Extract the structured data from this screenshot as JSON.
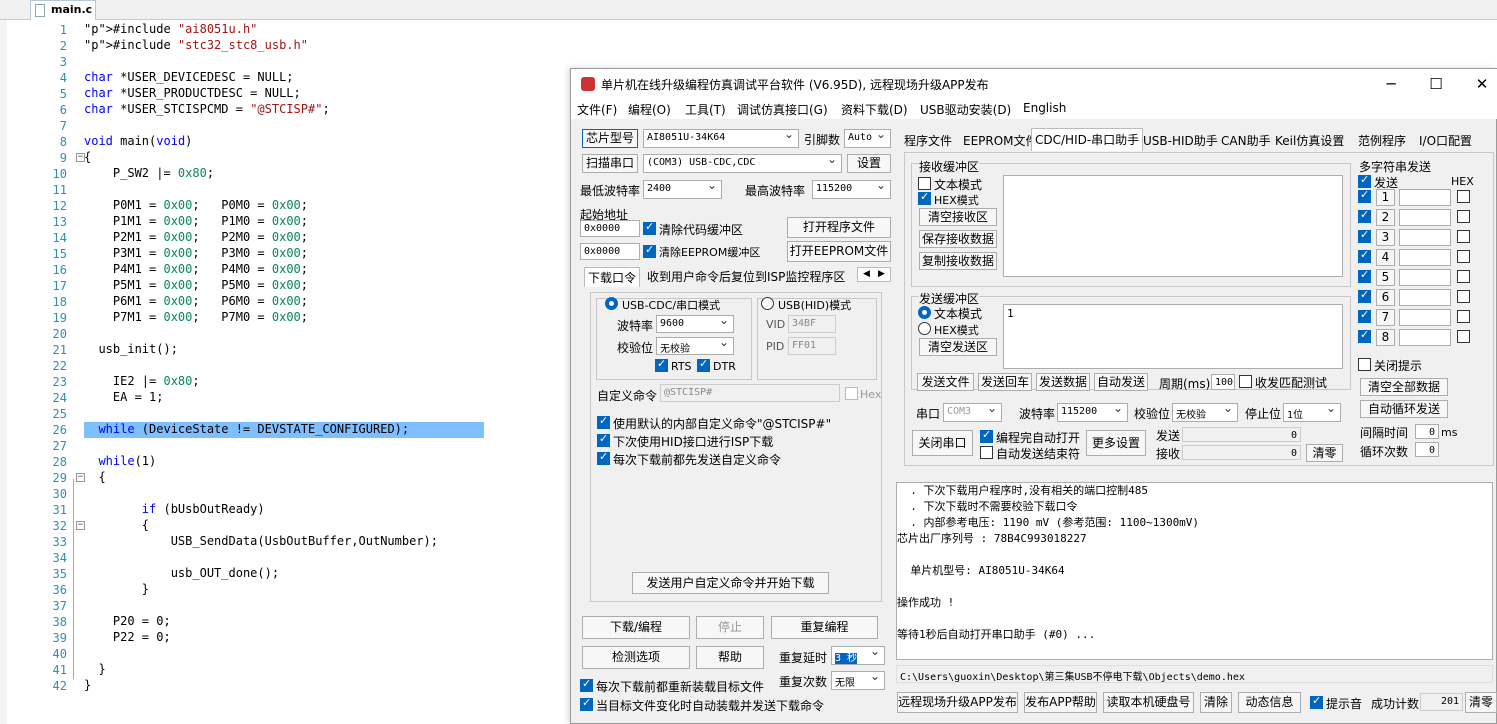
{
  "editor": {
    "tab_label": "main.c",
    "line_numbers": [
      "1",
      "2",
      "3",
      "4",
      "5",
      "6",
      "7",
      "8",
      "9",
      "10",
      "11",
      "12",
      "13",
      "14",
      "15",
      "16",
      "17",
      "18",
      "19",
      "20",
      "21",
      "22",
      "23",
      "24",
      "25",
      "26",
      "27",
      "28",
      "29",
      "30",
      "31",
      "32",
      "33",
      "34",
      "35",
      "36",
      "37",
      "38",
      "39",
      "40",
      "41",
      "42"
    ],
    "lines": {
      "l1": "#include \"ai8051u.h\"",
      "l2": "#include \"stc32_stc8_usb.h\"",
      "l4": "char *USER_DEVICEDESC = NULL;",
      "l5": "char *USER_PRODUCTDESC = NULL;",
      "l6": "char *USER_STCISPCMD = \"@STCISP#\";",
      "l8": "void main(void)",
      "l9": "{",
      "l10": "    P_SW2 |= 0x80;",
      "l12": "    P0M1 = 0x00;   P0M0 = 0x00;",
      "l13": "    P1M1 = 0x00;   P1M0 = 0x00;",
      "l14": "    P2M1 = 0x00;   P2M0 = 0x00;",
      "l15": "    P3M1 = 0x00;   P3M0 = 0x00;",
      "l16": "    P4M1 = 0x00;   P4M0 = 0x00;",
      "l17": "    P5M1 = 0x00;   P5M0 = 0x00;",
      "l18": "    P6M1 = 0x00;   P6M0 = 0x00;",
      "l19": "    P7M1 = 0x00;   P7M0 = 0x00;",
      "l21": "  usb_init();",
      "l23": "    IE2 |= 0x80;",
      "l24": "    EA = 1;",
      "l26": "  while (DeviceState != DEVSTATE_CONFIGURED);",
      "l28": "  while(1)",
      "l29": "  {",
      "l31": "        if (bUsbOutReady)",
      "l32": "        {",
      "l33": "            USB_SendData(UsbOutBuffer,OutNumber);",
      "l35": "            usb_OUT_done();",
      "l36": "        }",
      "l38": "    P20 = 0;",
      "l39": "    P22 = 0;",
      "l41": "  }",
      "l42": "}"
    }
  },
  "window": {
    "title": "单片机在线升级编程仿真调试平台软件 (V6.95D), 远程现场升级APP发布",
    "controls": {
      "minimize": "─",
      "maximize": "☐",
      "close": "✕"
    },
    "menu": [
      "文件(F)",
      "编程(O)",
      "工具(T)",
      "调试仿真接口(G)",
      "资料下载(D)",
      "USB驱动安装(D)",
      "English"
    ]
  },
  "left": {
    "chip_btn": "芯片型号",
    "chip_value": "AI8051U-34K64",
    "pins_label": "引脚数",
    "pins_value": "Auto",
    "scan_btn": "扫描串口",
    "port_value": "(COM3) USB-CDC,CDC",
    "settings_btn": "设置",
    "min_baud_label": "最低波特率",
    "min_baud_value": "2400",
    "max_baud_label": "最高波特率",
    "max_baud_value": "115200",
    "start_addr_label": "起始地址",
    "addr1": "0x0000",
    "clear_code": "清除代码缓冲区",
    "open_prog": "打开程序文件",
    "addr2": "0x0000",
    "clear_eeprom": "清除EEPROM缓冲区",
    "open_eeprom": "打开EEPROM文件",
    "tab1": "下载口令",
    "tab2": "收到用户命令后复位到ISP监控程序区",
    "mode_cdc": "USB-CDC/串口模式",
    "mode_hid": "USB(HID)模式",
    "baud_label": "波特率",
    "baud_value": "9600",
    "parity_label": "校验位",
    "parity_value": "无校验",
    "rts": "RTS",
    "dtr": "DTR",
    "vid_label": "VID",
    "vid_value": "34BF",
    "pid_label": "PID",
    "pid_value": "FF01",
    "custom_cmd_label": "自定义命令",
    "custom_cmd_value": "@STCISP#",
    "hex_label": "Hex",
    "opt1": "使用默认的内部自定义命令\"@STCISP#\"",
    "opt2": "下次使用HID接口进行ISP下载",
    "opt3": "每次下载前都先发送自定义命令",
    "send_cmd_btn": "发送用户自定义命令并开始下载",
    "download_btn": "下载/编程",
    "stop_btn": "停止",
    "reprog_btn": "重复编程",
    "check_btn": "检测选项",
    "help_btn": "帮助",
    "repeat_delay_label": "重复延时",
    "repeat_delay_value": "3 秒",
    "repeat_count_label": "重复次数",
    "repeat_count_value": "无限",
    "reload_each": "每次下载前都重新装载目标文件",
    "auto_reload": "当目标文件变化时自动装载并发送下载命令"
  },
  "right": {
    "tabs": [
      "程序文件",
      "EEPROM文件",
      "CDC/HID-串口助手",
      "USB-HID助手",
      "CAN助手",
      "Keil仿真设置",
      "范例程序",
      "I/O口配置"
    ],
    "recv_group": "接收缓冲区",
    "recv_text_mode": "文本模式",
    "recv_hex_mode": "HEX模式",
    "clear_recv": "清空接收区",
    "save_recv": "保存接收数据",
    "copy_recv": "复制接收数据",
    "send_group": "发送缓冲区",
    "send_text_mode": "文本模式",
    "send_hex_mode": "HEX模式",
    "clear_send": "清空发送区",
    "send_content": "1",
    "send_file": "发送文件",
    "send_enter": "发送回车",
    "send_data": "发送数据",
    "auto_send": "自动发送",
    "period_label": "周期(ms)",
    "period_value": "100",
    "recv_match": "收发匹配测试",
    "multi_title": "多字符串发送",
    "multi_send": "发送",
    "multi_hex": "HEX",
    "multi_rows": [
      "1",
      "2",
      "3",
      "4",
      "5",
      "6",
      "7",
      "8"
    ],
    "close_tip": "关闭提示",
    "clear_all": "清空全部数据",
    "auto_loop": "自动循环发送",
    "interval_label": "间隔时间",
    "interval_value": "0",
    "interval_unit": "ms",
    "loop_label": "循环次数",
    "loop_value": "0",
    "port_label": "串口",
    "port_value": "COM3",
    "baud_label": "波特率",
    "baud_value": "115200",
    "parity_label": "校验位",
    "parity_value": "无校验",
    "stop_label": "停止位",
    "stop_value": "1位",
    "close_port": "关闭串口",
    "auto_open": "编程完自动打开",
    "auto_end": "自动发送结束符",
    "more_settings": "更多设置",
    "send_count_label": "发送",
    "send_count": "0",
    "recv_count_label": "接收",
    "recv_count": "0",
    "clear_counts": "清零"
  },
  "log": {
    "lines": [
      "  . 下次下载用户程序时,没有相关的端口控制485",
      "  . 下次下载时不需要校验下载口令",
      "  . 内部参考电压: 1190 mV (参考范围: 1100~1300mV)",
      "芯片出厂序列号 : 78B4C993018227",
      "",
      "  单片机型号: AI8051U-34K64",
      "",
      "操作成功 !",
      "",
      "等待1秒后自动打开串口助手 (#0) ..."
    ]
  },
  "statusbar": {
    "path": "C:\\Users\\guoxin\\Desktop\\第三集USB不停电下载\\Objects\\demo.hex",
    "btn_publish": "远程现场升级APP发布",
    "btn_help": "发布APP帮助",
    "btn_disk": "读取本机硬盘号",
    "btn_clear": "清除",
    "btn_dyn": "动态信息",
    "sound_label": "提示音",
    "count_label": "成功计数",
    "count_value": "201",
    "clear_btn": "清零"
  }
}
